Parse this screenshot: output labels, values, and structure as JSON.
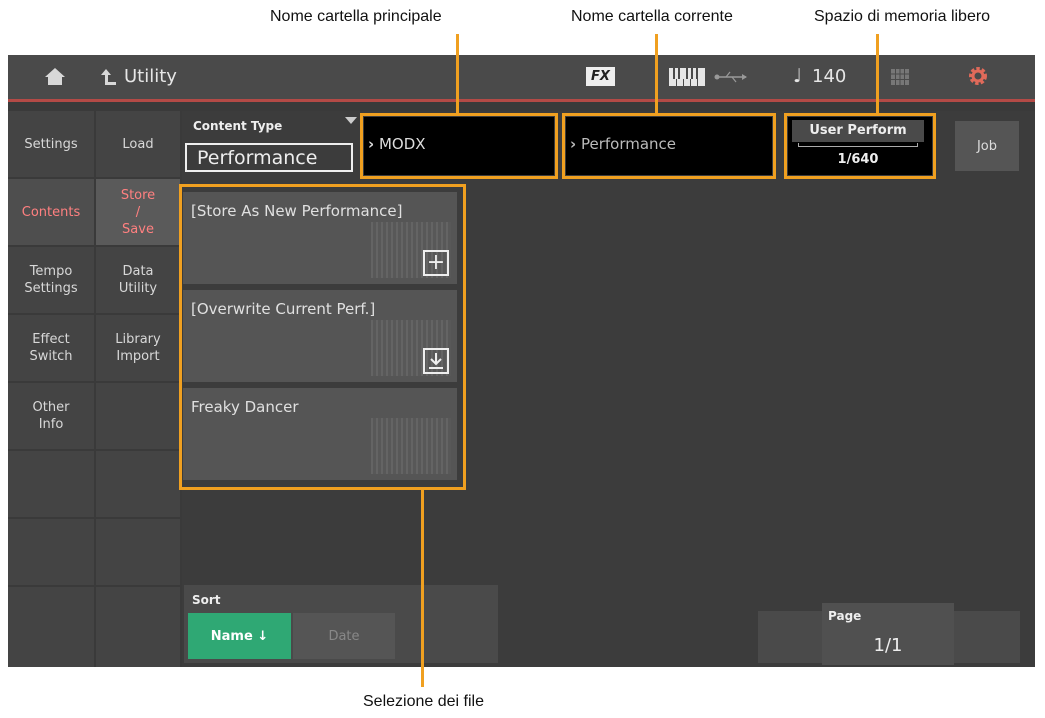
{
  "annotations": {
    "main_folder": "Nome cartella principale",
    "current_folder": "Nome cartella corrente",
    "free_memory": "Spazio di memoria libero",
    "file_selection": "Selezione dei file"
  },
  "topbar": {
    "title": "Utility",
    "fx_label": "FX",
    "tempo_symbol": "♩",
    "tempo_value": "140"
  },
  "sidebar_left": [
    {
      "label": "Settings"
    },
    {
      "label": "Contents"
    },
    {
      "label": "Tempo Settings"
    },
    {
      "label": "Effect Switch"
    },
    {
      "label": "Other Info"
    }
  ],
  "sidebar_right": [
    {
      "label": "Load"
    },
    {
      "label": "Store / Save"
    },
    {
      "label": "Data Utility"
    },
    {
      "label": "Library Import"
    }
  ],
  "content_type": {
    "label": "Content Type",
    "value": "Performance"
  },
  "main_folder_name": "MODX",
  "current_folder_name": "Performance",
  "memory": {
    "label": "User Perform",
    "value": "1/640"
  },
  "job_label": "Job",
  "files": [
    {
      "label": "[Store As New Performance]",
      "icon": "plus-icon"
    },
    {
      "label": "[Overwrite Current Perf.]",
      "icon": "download-icon"
    },
    {
      "label": "Freaky Dancer",
      "icon": ""
    }
  ],
  "sort": {
    "label": "Sort",
    "name_button": "Name ↓",
    "date_button": "Date"
  },
  "page": {
    "label": "Page",
    "value": "1/1"
  },
  "colors": {
    "accent": "#f0a020",
    "active_text": "#ff8080",
    "sort_active": "#2fa874"
  }
}
